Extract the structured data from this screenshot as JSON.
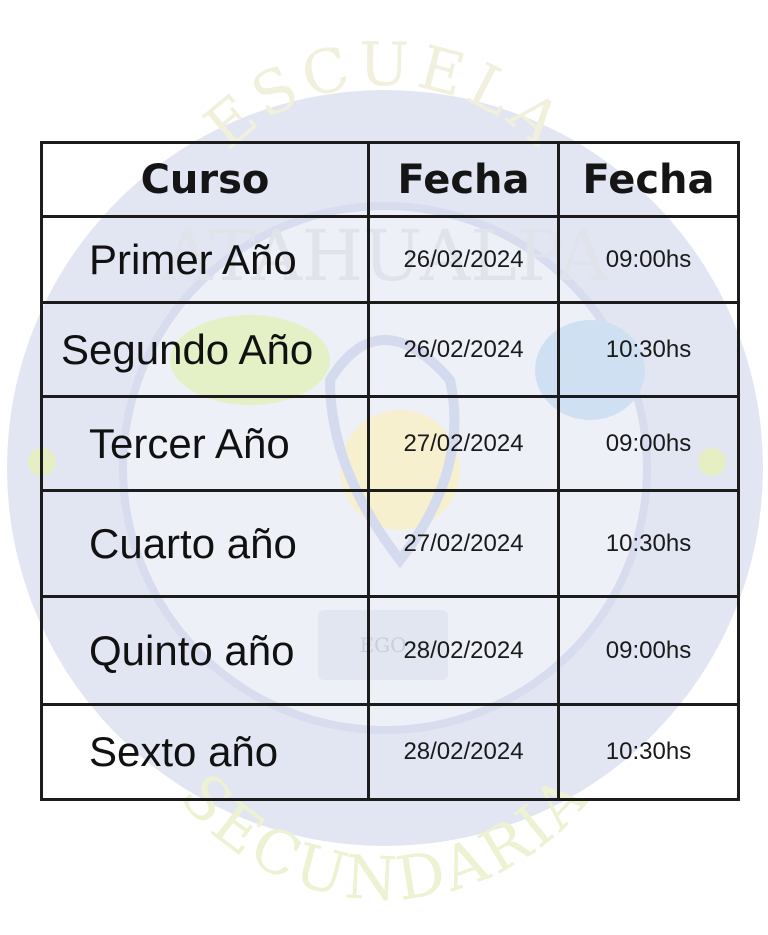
{
  "watermark": {
    "top_text": "ESCUELA",
    "school_name": "ATAHUALPA",
    "bottom_text": "SECUNDARIA",
    "book_text": "EGO",
    "colors": {
      "ring": "#dfe3f1",
      "inner": "#e7ebf5",
      "green": "#e6f0c8",
      "blue": "#c9dcef",
      "sun": "#f6efc8"
    }
  },
  "table": {
    "headers": [
      "Curso",
      "Fecha",
      "Fecha"
    ],
    "rows": [
      {
        "curso": "Primer Año",
        "fecha": "26/02/2024",
        "hora": "09:00hs"
      },
      {
        "curso": "Segundo Año",
        "fecha": "26/02/2024",
        "hora": "10:30hs"
      },
      {
        "curso": "Tercer Año",
        "fecha": "27/02/2024",
        "hora": "09:00hs"
      },
      {
        "curso": "Cuarto año",
        "fecha": "27/02/2024",
        "hora": "10:30hs"
      },
      {
        "curso": "Quinto año",
        "fecha": "28/02/2024",
        "hora": "09:00hs"
      },
      {
        "curso": "Sexto año",
        "fecha": "28/02/2024",
        "hora": "10:30hs"
      }
    ]
  }
}
